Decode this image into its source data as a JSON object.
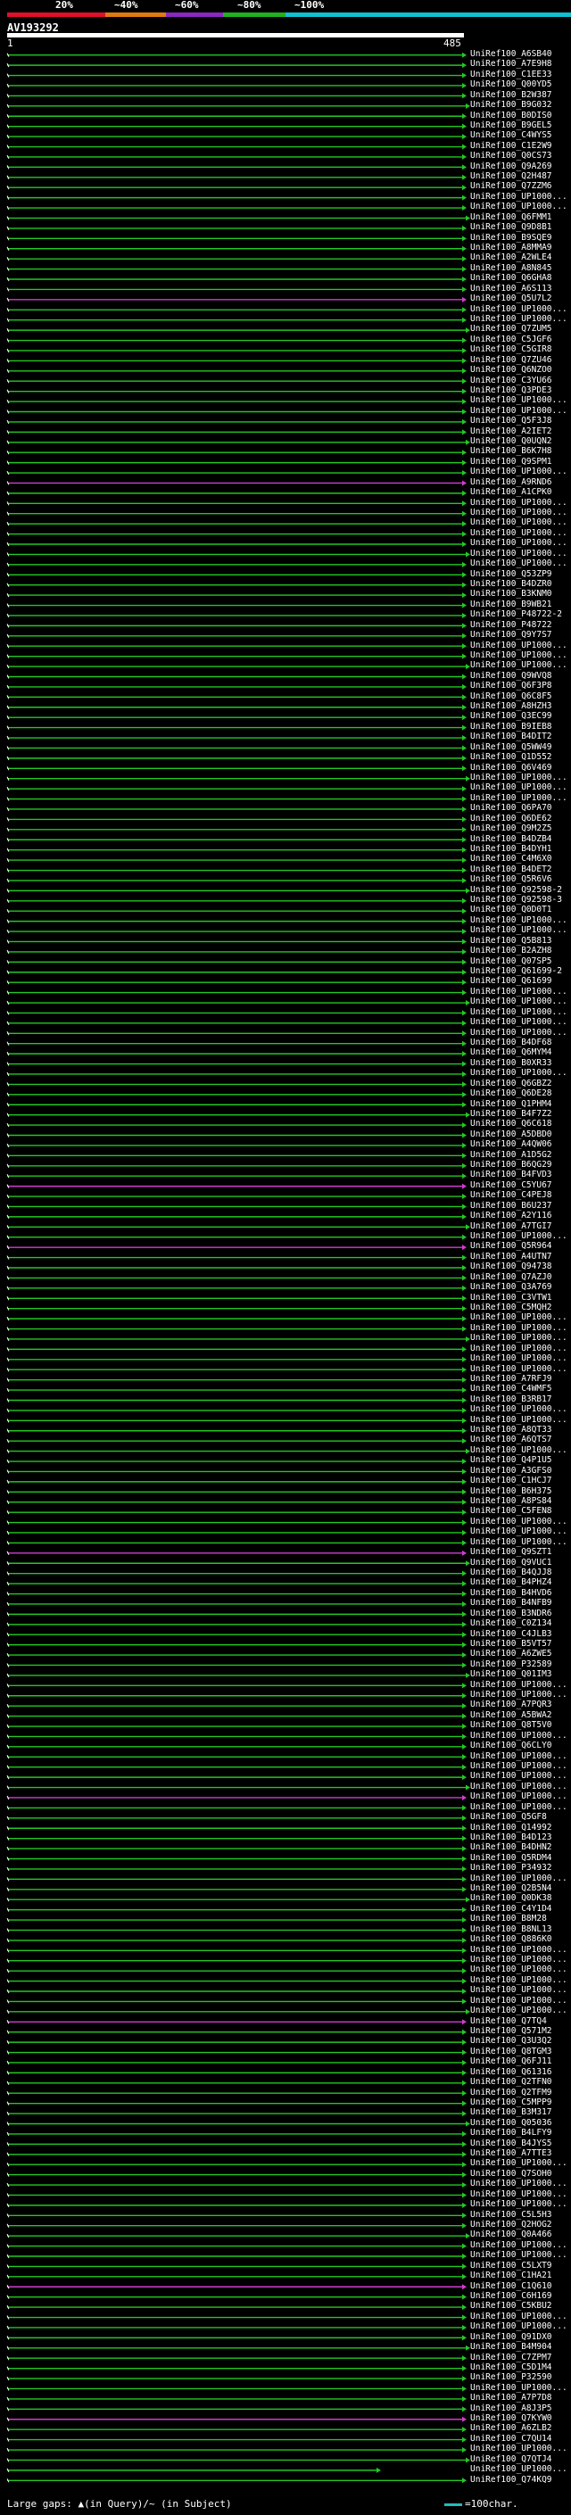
{
  "scale": {
    "labels": [
      "20%",
      "~40%",
      "~60%",
      "~80%",
      "~100%"
    ],
    "colors": [
      "#e0102a",
      "#e07a10",
      "#8a28c0",
      "#20b020",
      "#10c0d0"
    ]
  },
  "query": {
    "id": "AV193292",
    "start": "1",
    "end": "485"
  },
  "colors": {
    "green": "#23c823",
    "magenta": "#d23cd2",
    "white": "#ffffff"
  },
  "hits": [
    "UniRef100_A6SB40",
    "UniRef100_A7E9H8",
    "UniRef100_C1EE33",
    "UniRef100_Q00YD5",
    "UniRef100_B2W387",
    "UniRef100_B9G032",
    "UniRef100_B0DIS0",
    "UniRef100_B9GEL5",
    "UniRef100_C4WYS5",
    "UniRef100_C1E2W9",
    "UniRef100_Q0CS73",
    "UniRef100_Q9A269",
    "UniRef100_Q2H487",
    "UniRef100_Q7ZZM6",
    "UniRef100_UP1000...",
    "UniRef100_UP1000...",
    "UniRef100_Q6FMM1",
    "UniRef100_Q9D8B1",
    "UniRef100_B9SQE9",
    "UniRef100_A8MMA9",
    "UniRef100_A2WLE4",
    "UniRef100_A8N845",
    "UniRef100_Q6GHA8",
    "UniRef100_A6S113",
    "UniRef100_Q5U7L2",
    "UniRef100_UP1000...",
    "UniRef100_UP1000...",
    "UniRef100_Q7ZUM5",
    "UniRef100_C5JGF6",
    "UniRef100_C5GIR8",
    "UniRef100_Q7ZU46",
    "UniRef100_Q6NZO0",
    "UniRef100_C3YU66",
    "UniRef100_Q3PDE3",
    "UniRef100_UP1000...",
    "UniRef100_UP1000...",
    "UniRef100_Q5F3J8",
    "UniRef100_A2IET2",
    "UniRef100_Q0UQN2",
    "UniRef100_B6K7H8",
    "UniRef100_Q9SPM1",
    "UniRef100_UP1000...",
    "UniRef100_A9RND6",
    "UniRef100_A1CPK0",
    "UniRef100_UP1000...",
    "UniRef100_UP1000...",
    "UniRef100_UP1000...",
    "UniRef100_UP1000...",
    "UniRef100_UP1000...",
    "UniRef100_UP1000...",
    "UniRef100_UP1000...",
    "UniRef100_Q53ZP9",
    "UniRef100_B4DZR0",
    "UniRef100_B3KNM0",
    "UniRef100_B9WB21",
    "UniRef100_P48722-2",
    "UniRef100_P48722",
    "UniRef100_Q9Y7S7",
    "UniRef100_UP1000...",
    "UniRef100_UP1000...",
    "UniRef100_UP1000...",
    "UniRef100_Q9WVQ8",
    "UniRef100_Q6F3P8",
    "UniRef100_Q6C8F5",
    "UniRef100_A8HZH3",
    "UniRef100_Q3EC99",
    "UniRef100_B9IEB8",
    "UniRef100_B4DIT2",
    "UniRef100_Q5WW49",
    "UniRef100_Q1D552",
    "UniRef100_Q6V469",
    "UniRef100_UP1000...",
    "UniRef100_UP1000...",
    "UniRef100_UP1000...",
    "UniRef100_Q6PA70",
    "UniRef100_Q6DE62",
    "UniRef100_Q9M2Z5",
    "UniRef100_B4DZB4",
    "UniRef100_B4DYH1",
    "UniRef100_C4M6X0",
    "UniRef100_B4DET2",
    "UniRef100_Q5R6V6",
    "UniRef100_Q92598-2",
    "UniRef100_Q92598-3",
    "UniRef100_Q0D0T1",
    "UniRef100_UP1000...",
    "UniRef100_UP1000...",
    "UniRef100_Q5B813",
    "UniRef100_B2AZH8",
    "UniRef100_Q07SP5",
    "UniRef100_Q61699-2",
    "UniRef100_Q61699",
    "UniRef100_UP1000...",
    "UniRef100_UP1000...",
    "UniRef100_UP1000...",
    "UniRef100_UP1000...",
    "UniRef100_UP1000...",
    "UniRef100_B4DF68",
    "UniRef100_Q6MYM4",
    "UniRef100_B0XR33",
    "UniRef100_UP1000...",
    "UniRef100_Q6GBZ2",
    "UniRef100_Q6DE28",
    "UniRef100_Q1PHM4",
    "UniRef100_B4F7Z2",
    "UniRef100_Q6C618",
    "UniRef100_A5DBD0",
    "UniRef100_A4QW06",
    "UniRef100_A1D5G2",
    "UniRef100_B6QG29",
    "UniRef100_B4FVD3",
    "UniRef100_C5YU67",
    "UniRef100_C4PEJ8",
    "UniRef100_B6U237",
    "UniRef100_A2Y116",
    "UniRef100_A7TGI7",
    "UniRef100_UP1000...",
    "UniRef100_Q5R964",
    "UniRef100_A4UTN7",
    "UniRef100_Q94738",
    "UniRef100_Q7AZJ0",
    "UniRef100_Q3A769",
    "UniRef100_C3VTW1",
    "UniRef100_C5MQH2",
    "UniRef100_UP1000...",
    "UniRef100_UP1000...",
    "UniRef100_UP1000...",
    "UniRef100_UP1000...",
    "UniRef100_UP1000...",
    "UniRef100_UP1000...",
    "UniRef100_A7RFJ9",
    "UniRef100_C4WMF5",
    "UniRef100_B3RB17",
    "UniRef100_UP1000...",
    "UniRef100_UP1000...",
    "UniRef100_A8QT33",
    "UniRef100_A6QTS7",
    "UniRef100_UP1000...",
    "UniRef100_Q4P1U5",
    "UniRef100_A3GFS0",
    "UniRef100_C1HCJ7",
    "UniRef100_B6H375",
    "UniRef100_A8PS84",
    "UniRef100_C5FEN8",
    "UniRef100_UP1000...",
    "UniRef100_UP1000...",
    "UniRef100_UP1000...",
    "UniRef100_Q9SZT1",
    "UniRef100_Q9VUC1",
    "UniRef100_B4QJJ8",
    "UniRef100_B4PHZ4",
    "UniRef100_B4HVD6",
    "UniRef100_B4NFB9",
    "UniRef100_B3NDR6",
    "UniRef100_C0Z134",
    "UniRef100_C4JLB3",
    "UniRef100_B5VT57",
    "UniRef100_A6ZWE5",
    "UniRef100_P32589",
    "UniRef100_Q01IM3",
    "UniRef100_UP1000...",
    "UniRef100_UP1000...",
    "UniRef100_A7PQR3",
    "UniRef100_A5BWA2",
    "UniRef100_Q8T5V0",
    "UniRef100_UP1000...",
    "UniRef100_Q6CLY0",
    "UniRef100_UP1000...",
    "UniRef100_UP1000...",
    "UniRef100_UP1000...",
    "UniRef100_UP1000...",
    "UniRef100_UP1000...",
    "UniRef100_UP1000...",
    "UniRef100_Q5GF8",
    "UniRef100_Q14992",
    "UniRef100_B4D123",
    "UniRef100_B4DHN2",
    "UniRef100_Q5RDM4",
    "UniRef100_P34932",
    "UniRef100_UP1000...",
    "UniRef100_Q2B5N4",
    "UniRef100_Q0DK38",
    "UniRef100_C4Y1D4",
    "UniRef100_B8M28",
    "UniRef100_B8NL13",
    "UniRef100_Q886K0",
    "UniRef100_UP1000...",
    "UniRef100_UP1000...",
    "UniRef100_UP1000...",
    "UniRef100_UP1000...",
    "UniRef100_UP1000...",
    "UniRef100_UP1000...",
    "UniRef100_UP1000...",
    "UniRef100_Q7TQ4",
    "UniRef100_Q571M2",
    "UniRef100_Q3U3Q2",
    "UniRef100_Q8TGM3",
    "UniRef100_Q6FJ11",
    "UniRef100_Q61316",
    "UniRef100_Q2TFN0",
    "UniRef100_Q2TFM9",
    "UniRef100_C5MPP9",
    "UniRef100_B3M317",
    "UniRef100_Q05036",
    "UniRef100_B4LFY9",
    "UniRef100_B4JYS5",
    "UniRef100_A7TTE3",
    "UniRef100_UP1000...",
    "UniRef100_Q7SOH0",
    "UniRef100_UP1000...",
    "UniRef100_UP1000...",
    "UniRef100_UP1000...",
    "UniRef100_C5L5H3",
    "UniRef100_Q2HOG2",
    "UniRef100_Q0A466",
    "UniRef100_UP1000...",
    "UniRef100_UP1000...",
    "UniRef100_C5LXT9",
    "UniRef100_C1HA21",
    "UniRef100_C1Q610",
    "UniRef100_C6H169",
    "UniRef100_C5KBU2",
    "UniRef100_UP1000...",
    "UniRef100_UP1000...",
    "UniRef100_Q91DX0",
    "UniRef100_B4M904",
    "UniRef100_C7ZPM7",
    "UniRef100_C5D1M4",
    "UniRef100_P32590",
    "UniRef100_UP1000...",
    "UniRef100_A7P7D8",
    "UniRef100_A8J3P5",
    "UniRef100_Q7KYW0",
    "UniRef100_A6ZLB2",
    "UniRef100_C7QU14",
    "UniRef100_UP1000...",
    "UniRef100_Q7QTJ4",
    "UniRef100_UP1000...",
    "UniRef100_Q74KQ9"
  ],
  "footer": {
    "text": "Large gaps: ▲(in Query)/~ (in Subject)",
    "legend": "=100char."
  }
}
